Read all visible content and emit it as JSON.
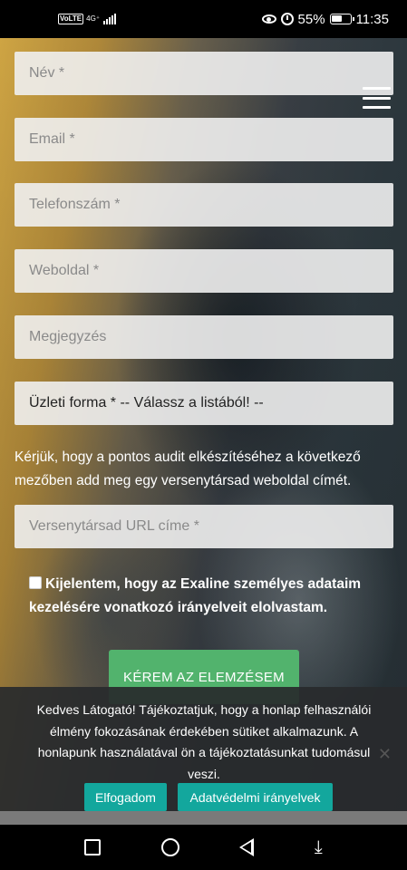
{
  "status_bar": {
    "network_badge": "VoLTE",
    "network_type": "4G⁺",
    "battery_percent": "55%",
    "time": "11:35"
  },
  "form": {
    "name_placeholder": "Név *",
    "email_placeholder": "Email *",
    "phone_placeholder": "Telefonszám *",
    "website_placeholder": "Weboldal *",
    "note_placeholder": "Megjegyzés",
    "business_form_select": "Üzleti forma * -- Válassz a listából! --",
    "info_text": "Kérjük, hogy a pontos audit elkészítéséhez a következő mezőben add meg egy versenytársad weboldal címét.",
    "competitor_placeholder": "Versenytársad URL címe *",
    "consent_text": "Kijelentem, hogy az Exaline személyes adataim kezelésére vonatkozó irányelveit elolvastam.",
    "consent_checked": false,
    "submit_label": "KÉREM AZ ELEMZÉSEM"
  },
  "cookie_banner": {
    "text": "Kedves Látogató! Tájékoztatjuk, hogy a honlap felhasználói élmény fokozásának érdekében sütiket alkalmazunk. A honlapunk használatával ön a tájékoztatásunkat tudomásul veszi.",
    "accept_label": "Elfogadom",
    "privacy_label": "Adatvédelmi irányelvek",
    "close_glyph": "✕",
    "chevron_glyph": "⌄"
  },
  "colors": {
    "submit_green": "#52b36d",
    "cookie_button_teal": "#13a79d",
    "field_background": "#f0f0f0"
  },
  "icons": {
    "menu": "hamburger-icon",
    "cookie_close": "close-icon",
    "nav": [
      "square-recents-icon",
      "circle-home-icon",
      "triangle-back-icon",
      "notification-pulldown-icon"
    ]
  }
}
